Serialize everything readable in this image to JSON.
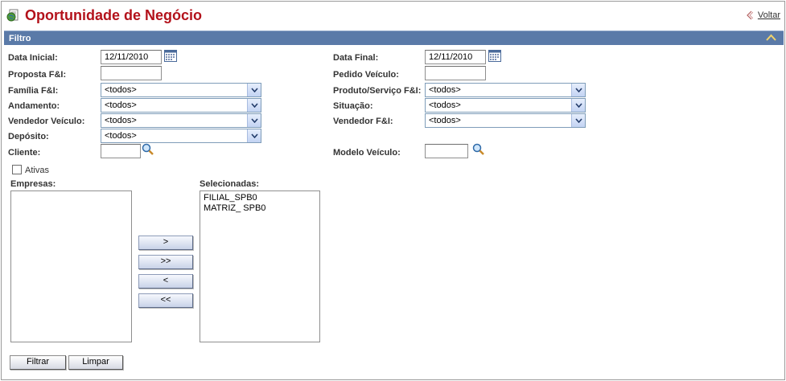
{
  "header": {
    "title": "Oportunidade de Negócio",
    "back_label": "Voltar"
  },
  "panel": {
    "title": "Filtro"
  },
  "fields": {
    "data_inicial": {
      "label": "Data Inicial:",
      "value": "12/11/2010"
    },
    "data_final": {
      "label": "Data Final:",
      "value": "12/11/2010"
    },
    "proposta": {
      "label": "Proposta F&I:",
      "value": ""
    },
    "pedido_veiculo": {
      "label": "Pedido Veículo:",
      "value": ""
    },
    "familia": {
      "label": "Família F&I:",
      "value": "<todos>"
    },
    "produto_servico": {
      "label": "Produto/Serviço F&I:",
      "value": "<todos>"
    },
    "andamento": {
      "label": "Andamento:",
      "value": "<todos>"
    },
    "situacao": {
      "label": "Situação:",
      "value": "<todos>"
    },
    "vendedor_veiculo": {
      "label": "Vendedor Veículo:",
      "value": "<todos>"
    },
    "vendedor_fi": {
      "label": "Vendedor F&I:",
      "value": "<todos>"
    },
    "deposito": {
      "label": "Depósito:",
      "value": "<todos>"
    },
    "cliente": {
      "label": "Cliente:",
      "value": ""
    },
    "modelo_veiculo": {
      "label": "Modelo Veículo:",
      "value": ""
    },
    "ativas": {
      "label": "Ativas",
      "checked": false
    }
  },
  "empresas": {
    "label": "Empresas:",
    "items": []
  },
  "selecionadas": {
    "label": "Selecionadas:",
    "items": [
      "FILIAL_SPB0",
      "MATRIZ_ SPB0"
    ]
  },
  "move_buttons": {
    "add": ">",
    "add_all": ">>",
    "remove": "<",
    "remove_all": "<<"
  },
  "actions": {
    "filter": "Filtrar",
    "clear": "Limpar"
  },
  "colors": {
    "title": "#b3121b",
    "panel_header": "#5a7aa8"
  }
}
